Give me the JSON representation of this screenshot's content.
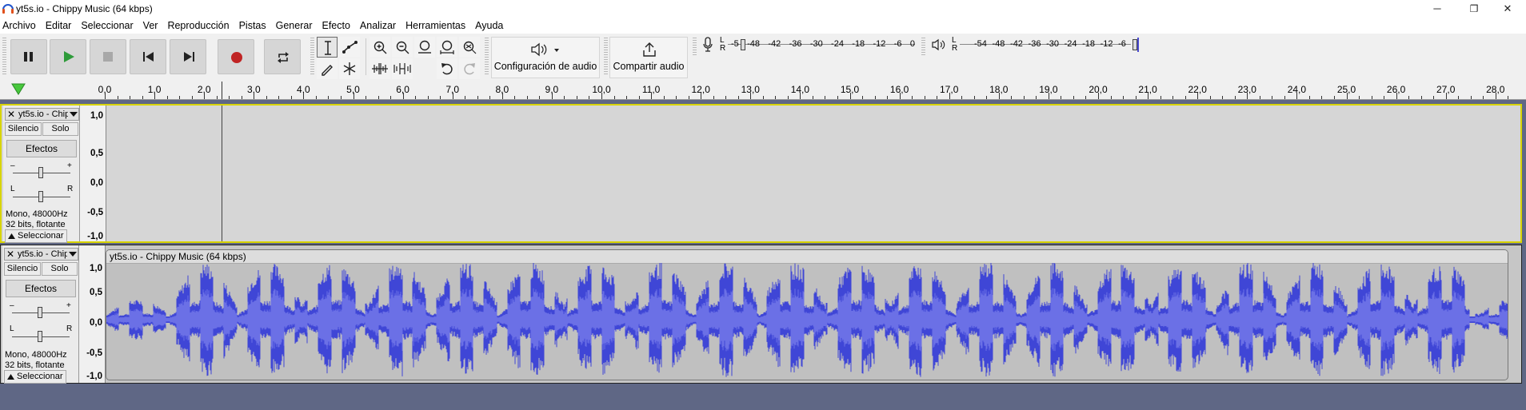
{
  "window": {
    "title": "yt5s.io - Chippy Music (64 kbps)",
    "controls": {
      "minimize": "─",
      "maximize": "❐",
      "close": "✕"
    }
  },
  "menu": [
    "Archivo",
    "Editar",
    "Seleccionar",
    "Ver",
    "Reproducción",
    "Pistas",
    "Generar",
    "Efecto",
    "Analizar",
    "Herramientas",
    "Ayuda"
  ],
  "toolbar": {
    "config_audio": "Configuración de audio",
    "share_audio": "Compartir audio",
    "rec_meter": {
      "l": "L",
      "r": "R",
      "scale": [
        "-5",
        "-48",
        "-42",
        "-36",
        "-30",
        "-24",
        "-18",
        "-12",
        "-6",
        "0"
      ]
    },
    "play_meter": {
      "l": "L",
      "r": "R",
      "scale": [
        "-54",
        "-48",
        "-42",
        "-36",
        "-30",
        "-24",
        "-18",
        "-12",
        "-6"
      ]
    }
  },
  "ruler": {
    "ticks": [
      "0,0",
      "1,0",
      "2,0",
      "3,0",
      "4,0",
      "5,0",
      "6,0",
      "7,0",
      "8,0",
      "9,0",
      "10,0",
      "11,0",
      "12,0",
      "13,0",
      "14,0",
      "15,0",
      "16,0",
      "17,0",
      "18,0",
      "19,0",
      "20,0",
      "21,0",
      "22,0",
      "23,0",
      "24,0",
      "25,0",
      "26,0",
      "27,0",
      "28,0"
    ]
  },
  "tracks": [
    {
      "name": "yt5s.io - Chip",
      "mute": "Silencio",
      "solo": "Solo",
      "effects": "Efectos",
      "gain_minus": "–",
      "gain_plus": "+",
      "pan_l": "L",
      "pan_r": "R",
      "info1": "Mono, 48000Hz",
      "info2": "32 bits, flotante",
      "select": "Seleccionar",
      "vruler": [
        "1,0",
        "0,5",
        "0,0",
        "-0,5",
        "-1,0"
      ],
      "clip_name": ""
    },
    {
      "name": "yt5s.io - Chip",
      "mute": "Silencio",
      "solo": "Solo",
      "effects": "Efectos",
      "gain_minus": "–",
      "gain_plus": "+",
      "pan_l": "L",
      "pan_r": "R",
      "info1": "Mono, 48000Hz",
      "info2": "32 bits, flotante",
      "select": "Seleccionar",
      "vruler": [
        "1,0",
        "0,5",
        "0,0",
        "-0,5",
        "-1,0"
      ],
      "clip_name": "yt5s.io - Chippy Music (64 kbps)"
    }
  ],
  "colors": {
    "waveform": "#3f46d6",
    "waveform_rms": "#6b70e6",
    "record": "#c02424",
    "play": "#2e9b3a",
    "selected_border": "#d8d400"
  }
}
